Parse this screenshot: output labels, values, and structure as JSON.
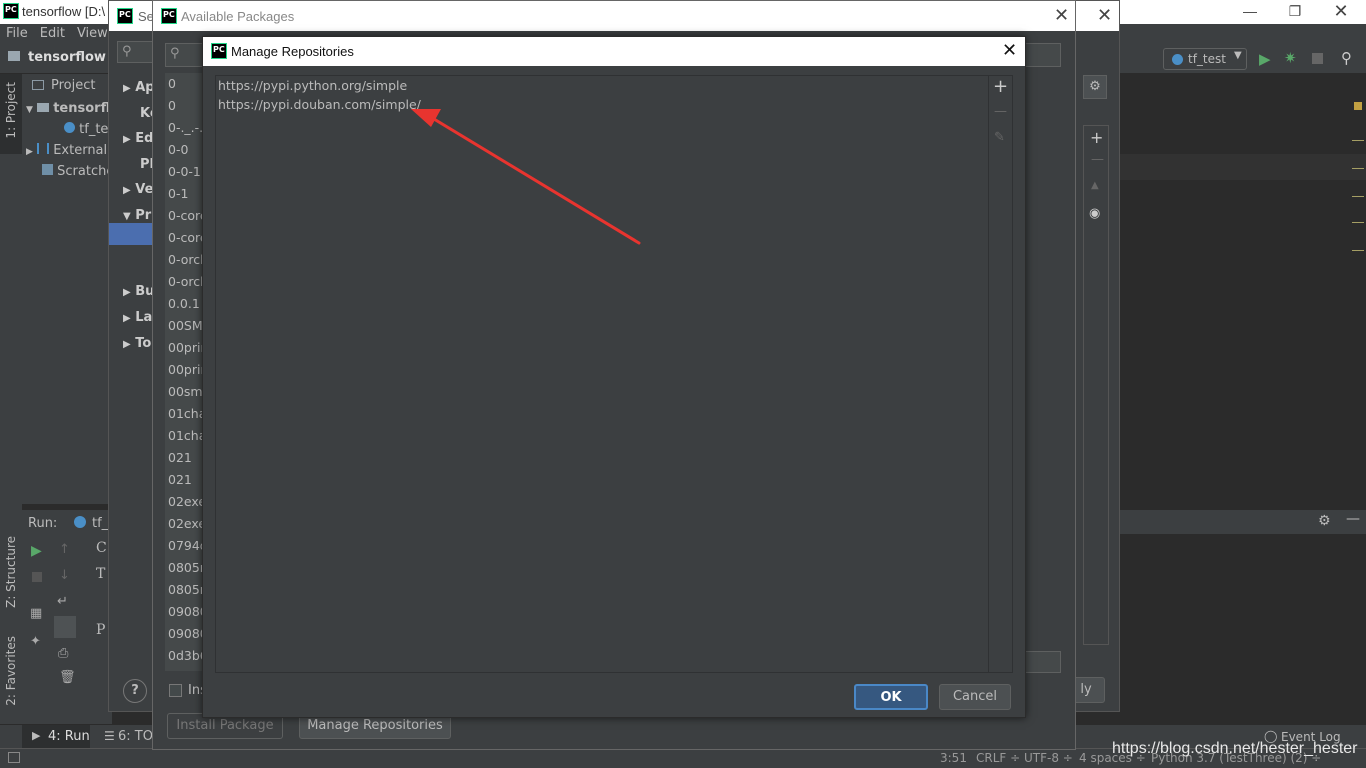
{
  "main_window": {
    "title": "tensorflow [D:\\",
    "menu": [
      "File",
      "Edit",
      "View"
    ],
    "breadcrumb": "tensorflow",
    "run_config": "tf_test"
  },
  "project_panel": {
    "tab_label": "Project",
    "strip_label": "1: Project",
    "tree": [
      "tensorfl",
      "tf_tes",
      "External",
      "Scratche"
    ]
  },
  "left_tool_strip": {
    "structure": "Z: Structure",
    "favorites": "2: Favorites"
  },
  "run_panel": {
    "label": "Run:",
    "config": "tf_t",
    "console_lines": [
      "C",
      "T",
      "P"
    ]
  },
  "settings_dialog": {
    "title_fragment": "Se",
    "nav_items": [
      "Ap",
      "Ke",
      "Ed",
      "Pl",
      "Ve",
      "Pr",
      "Bu",
      "La",
      "To"
    ],
    "checkbox_label": "Ins",
    "apply_label": "ly"
  },
  "available_packages": {
    "title": "Available Packages",
    "packages": [
      "0",
      "0",
      "0-._.-._",
      "0-0",
      "0-0-1",
      "0-1",
      "0-core",
      "0-core",
      "0-orch",
      "0-orch",
      "0.0.1",
      "00SMA",
      "00prin",
      "00prin",
      "00sma",
      "01cha",
      "01cha",
      "021",
      "021",
      "02exe",
      "02exe",
      "0794d",
      "0805n",
      "0805n",
      "09080",
      "09080",
      "0d3b6"
    ],
    "install_button": "Install Package",
    "manage_button": "Manage Repositories"
  },
  "manage_repositories": {
    "title": "Manage Repositories",
    "repositories": [
      "https://pypi.python.org/simple",
      "https://pypi.douban.com/simple/"
    ],
    "ok_label": "OK",
    "cancel_label": "Cancel"
  },
  "bottom_tabs": [
    "4: Run",
    "6: TOD"
  ],
  "status_bar": {
    "position": "3:51",
    "line_sep": "CRLF ÷",
    "encoding": "UTF-8 ÷",
    "indent": "4 spaces ÷",
    "interpreter": "Python 3.7 (TestThree) (2) ÷",
    "event_log": "Event Log",
    "watermark": "https://blog.csdn.net/hester_hester"
  },
  "colors": {
    "accent_arrow": "#e8342f",
    "ok_button": "#365880",
    "selected_nav": "#4b6eaf"
  }
}
